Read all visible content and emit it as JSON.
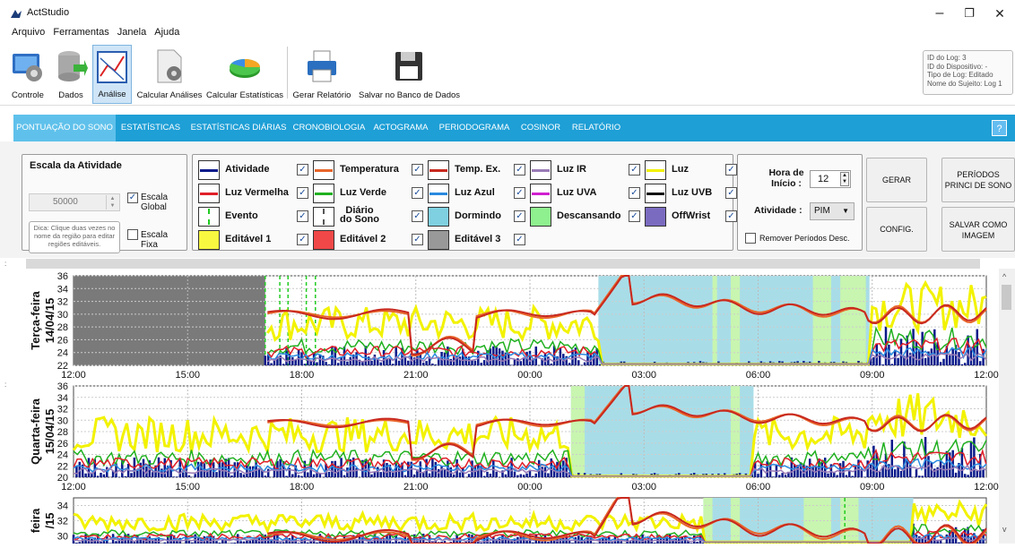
{
  "app": {
    "title": "ActStudio"
  },
  "window": {
    "minimize": "–",
    "maximize": "❐",
    "close": "✕"
  },
  "menu": [
    "Arquivo",
    "Ferramentas",
    "Janela",
    "Ajuda"
  ],
  "toolbar": [
    {
      "label": "Controle",
      "icon": "gear-monitor-icon"
    },
    {
      "label": "Dados",
      "icon": "database-icon"
    },
    {
      "label": "Análise",
      "icon": "chart-analysis-icon"
    },
    {
      "label": "Calcular Análises",
      "icon": "document-gear-icon"
    },
    {
      "label": "Calcular Estatísticas",
      "icon": "pie-chart-icon"
    },
    {
      "label": "Gerar Relatório",
      "icon": "printer-icon"
    },
    {
      "label": "Salvar no Banco de Dados",
      "icon": "floppy-icon"
    }
  ],
  "loginfo": [
    "ID do Log: 3",
    "ID do Dispositivo: -",
    "Tipo de Log: Editado",
    "Nome do Sujeito: Log 1"
  ],
  "tabs": [
    "PONTUAÇÃO DO SONO",
    "ESTATÍSTICAS",
    "ESTATÍSTICAS DIÁRIAS",
    "CRONOBIOLOGIA",
    "ACTOGRAMA",
    "PERIODOGRAMA",
    "COSINOR",
    "RELATÓRIO"
  ],
  "help": "?",
  "activity_scale": {
    "title": "Escala da Atividade",
    "value": "50000",
    "global_label": "Escala Global",
    "fixed_label": "Escala Fixa",
    "tip": "Dica: Clique duas vezes no nome da região para editar regiões editáveis."
  },
  "legend": [
    {
      "label": "Atividade",
      "color": "#0a1a8a",
      "kind": "line"
    },
    {
      "label": "Temperatura",
      "color": "#e8652a",
      "kind": "line"
    },
    {
      "label": "Temp. Ex.",
      "color": "#c8281e",
      "kind": "line"
    },
    {
      "label": "Luz IR",
      "color": "#9a7bb6",
      "kind": "line"
    },
    {
      "label": "Luz",
      "color": "#f2f200",
      "kind": "line"
    },
    {
      "label": "Luz Vermelha",
      "color": "#e0202a",
      "kind": "line"
    },
    {
      "label": "Luz Verde",
      "color": "#20b020",
      "kind": "line"
    },
    {
      "label": "Luz Azul",
      "color": "#2a8ae0",
      "kind": "line"
    },
    {
      "label": "Luz UVA",
      "color": "#d020d0",
      "kind": "line"
    },
    {
      "label": "Luz UVB",
      "color": "#111111",
      "kind": "line"
    },
    {
      "label": "Evento",
      "color": "#22cc22",
      "kind": "dash"
    },
    {
      "label": "Diário do Sono",
      "color": "#555555",
      "kind": "dash"
    },
    {
      "label": "Dormindo",
      "color": "#7fd0e0",
      "kind": "fill"
    },
    {
      "label": "Descansando",
      "color": "#8ef08e",
      "kind": "fill"
    },
    {
      "label": "OffWrist",
      "color": "#7b6bc0",
      "kind": "fill"
    },
    {
      "label": "Editável 1",
      "color": "#f8f840",
      "kind": "fill"
    },
    {
      "label": "Editável 2",
      "color": "#f04848",
      "kind": "fill"
    },
    {
      "label": "Editável 3",
      "color": "#999999",
      "kind": "fill"
    }
  ],
  "controls": {
    "start_label": "Hora de Início :",
    "start_value": "12",
    "activity_label": "Atividade :",
    "activity_value": "PIM",
    "remove_label": "Remover Períodos Desc.",
    "gerar": "GERAR",
    "config": "CONFIG.",
    "periods": "PERÍODOS PRINCI DE SONO",
    "save_image": "SALVAR COMO IMAGEM"
  },
  "days": [
    {
      "weekday": "Terça-feira",
      "date": "14/04/15"
    },
    {
      "weekday": "Quarta-feira",
      "date": "15/04/15"
    },
    {
      "weekday": "feira",
      "date": "/15"
    }
  ],
  "chart_data": {
    "type": "line",
    "y_ticks": [
      "36",
      "34",
      "32",
      "30",
      "28",
      "26",
      "24",
      "22"
    ],
    "y_ticks2": [
      "36",
      "34",
      "32",
      "30",
      "28",
      "26",
      "24",
      "22",
      "20"
    ],
    "x_ticks": [
      "12:00",
      "15:00",
      "18:00",
      "21:00",
      "00:00",
      "03:00",
      "06:00",
      "09:00",
      "12:00"
    ]
  }
}
